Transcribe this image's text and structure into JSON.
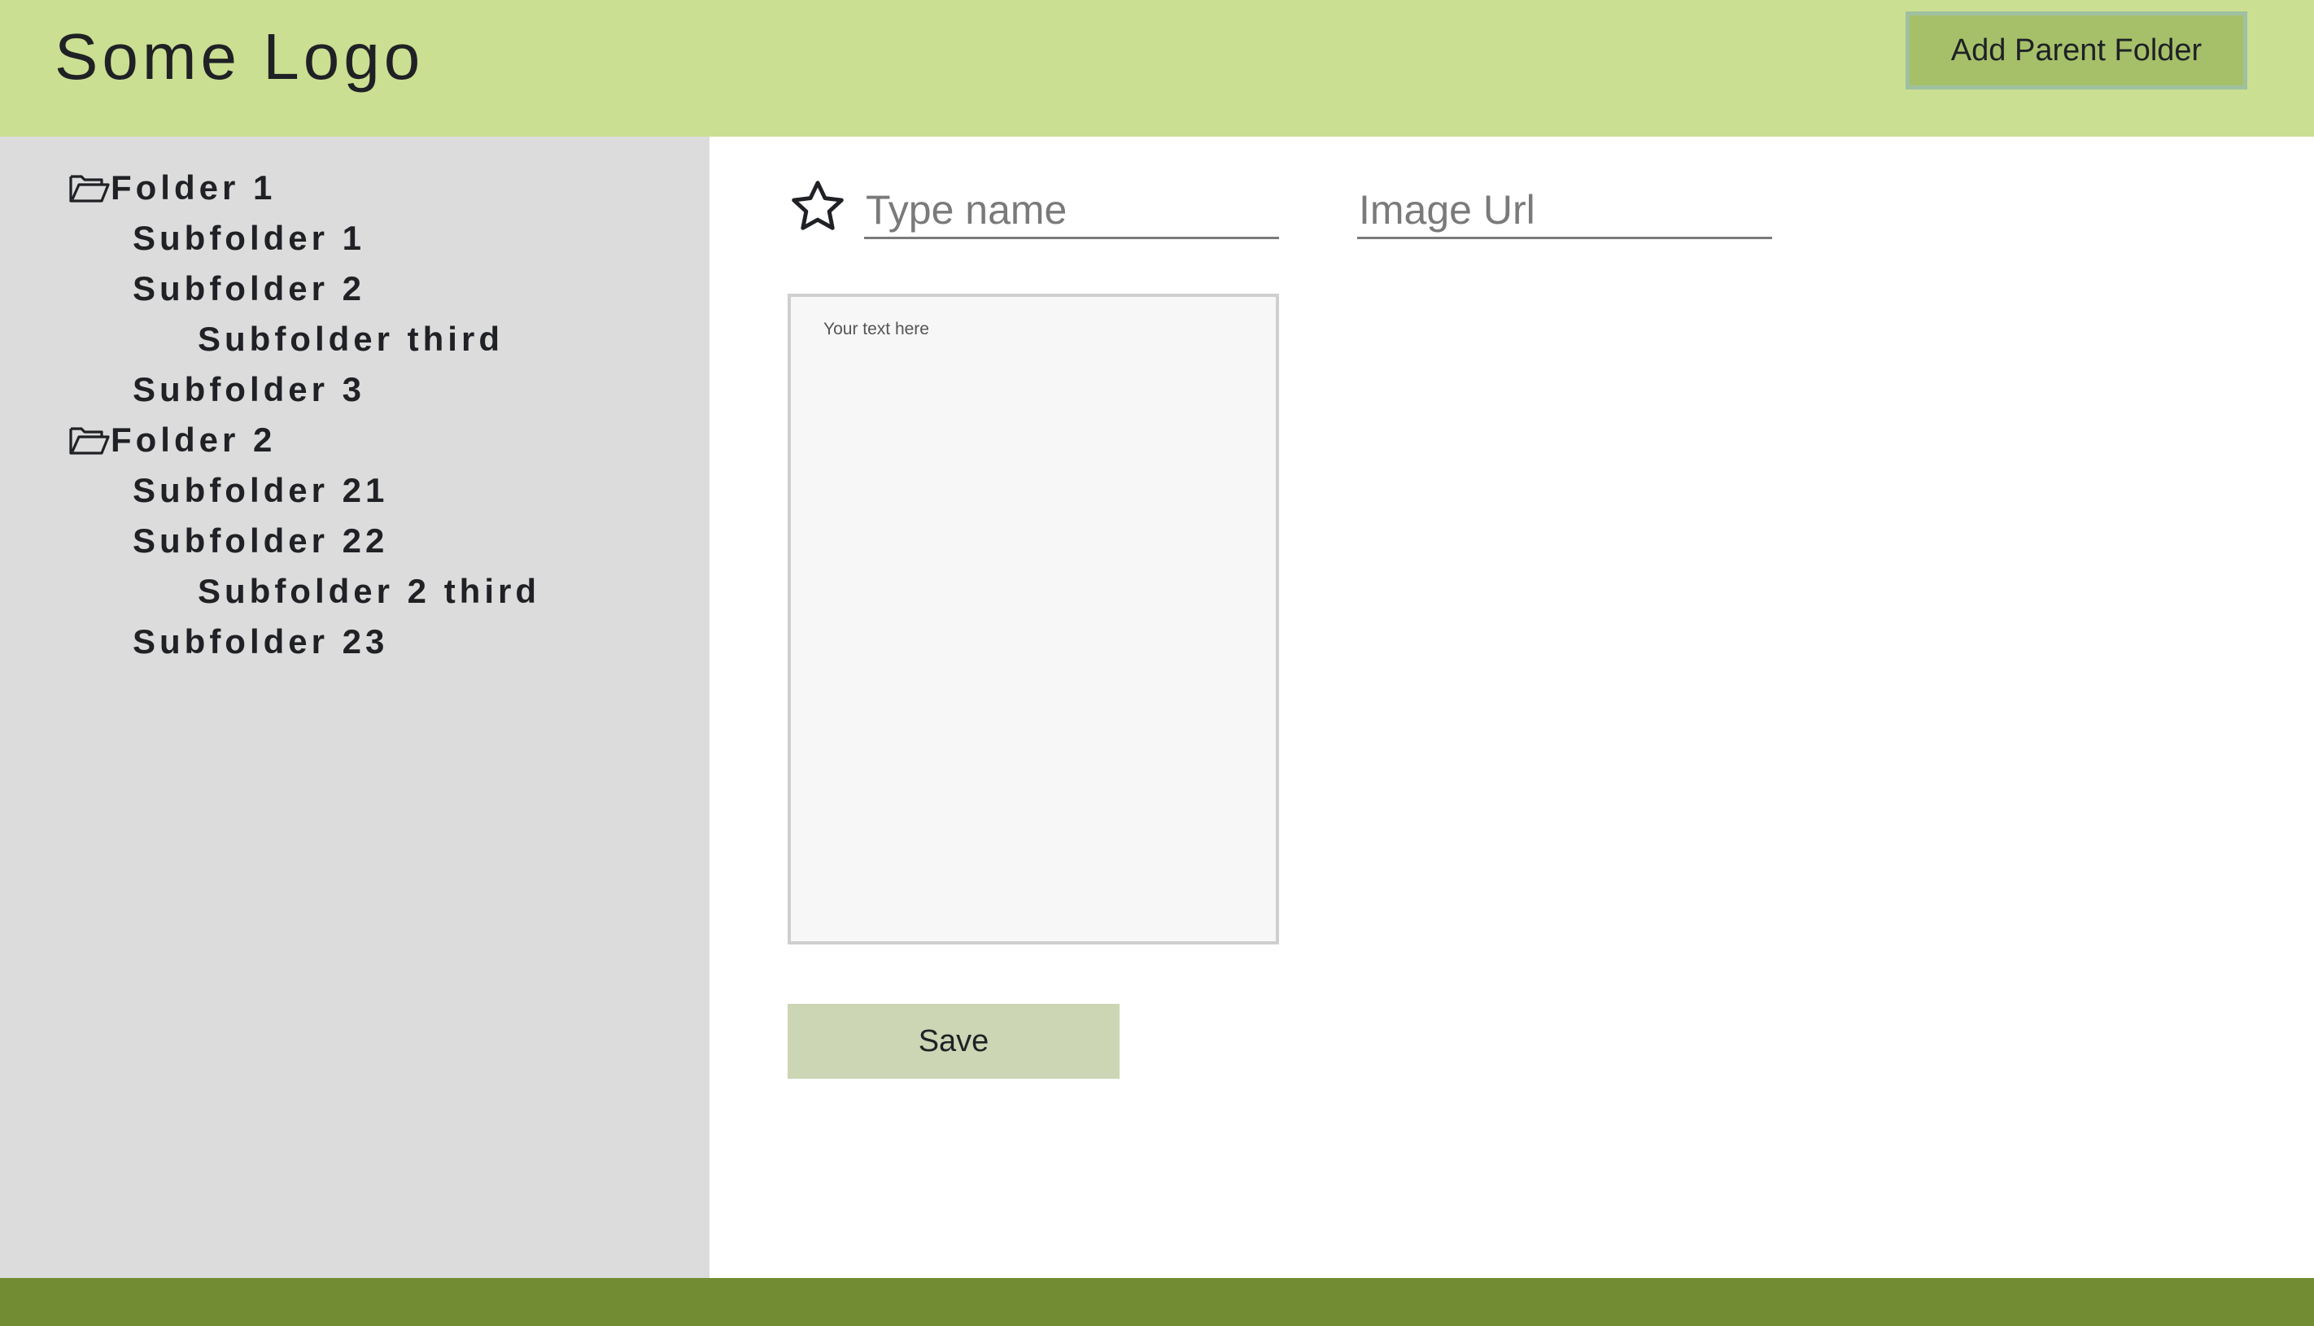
{
  "header": {
    "logo_text": "Some Logo",
    "add_parent_label": "Add Parent Folder"
  },
  "sidebar": {
    "tree": [
      {
        "label": "Folder 1",
        "level": 0,
        "icon": "folder-open-icon"
      },
      {
        "label": "Subfolder 1",
        "level": 1
      },
      {
        "label": "Subfolder 2",
        "level": 1
      },
      {
        "label": "Subfolder third",
        "level": 2
      },
      {
        "label": "Subfolder 3",
        "level": 1
      },
      {
        "label": "Folder 2",
        "level": 0,
        "icon": "folder-open-icon"
      },
      {
        "label": "Subfolder 21",
        "level": 1
      },
      {
        "label": "Subfolder 22",
        "level": 1
      },
      {
        "label": "Subfolder 2 third",
        "level": 2
      },
      {
        "label": "Subfolder 23",
        "level": 1
      }
    ]
  },
  "editor": {
    "favorite_icon": "star-outline-icon",
    "name_placeholder": "Type name",
    "name_value": "",
    "url_placeholder": "Image Url",
    "url_value": "",
    "text_placeholder": "Your text here",
    "text_value": "",
    "save_label": "Save"
  },
  "colors": {
    "header_bg": "#cadf92",
    "button_bg": "#a6c06a",
    "sidebar_bg": "#dcdcdc",
    "save_bg": "#ccd5b4",
    "footer_bg": "#728c34"
  }
}
